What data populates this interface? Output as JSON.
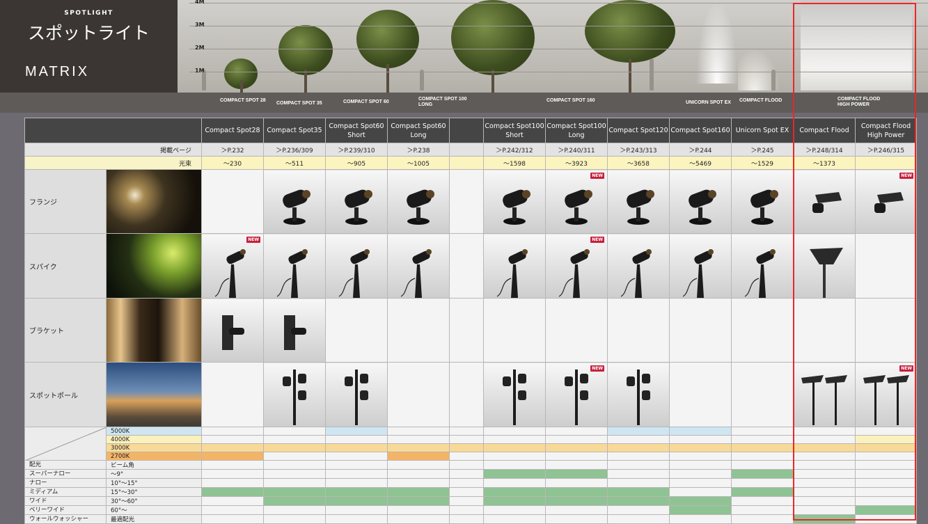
{
  "header": {
    "subtitle": "SPOTLIGHT",
    "title": "スポットライト",
    "matrix": "MATRIX"
  },
  "scale": [
    "4M",
    "3M",
    "2M",
    "1M"
  ],
  "captions": [
    "COMPACT SPOT 28",
    "COMPACT SPOT 35",
    "COMPACT SPOT 60",
    "COMPACT SPOT 100\nLONG",
    "COMPACT SPOT 160",
    "UNICORN SPOT EX",
    "COMPACT FLOOD",
    "COMPACT FLOOD\nHIGH POWER"
  ],
  "columns": [
    "Compact Spot28",
    "Compact Spot35",
    "Compact Spot60\nShort",
    "Compact Spot60\nLong",
    "",
    "Compact Spot100\nShort",
    "Compact Spot100\nLong",
    "Compact Spot120",
    "Compact Spot160",
    "Unicorn Spot EX",
    "Compact Flood",
    "Compact Flood\nHigh Power"
  ],
  "page_label": "掲載ページ",
  "pages": [
    "＞P.232",
    "＞P.236/309",
    "＞P.239/310",
    "＞P.238",
    "",
    "＞P.242/312",
    "＞P.240/311",
    "＞P.243/313",
    "＞P.244",
    "＞P.245",
    "＞P.248/314",
    "＞P.246/315"
  ],
  "lumen_label": "光束",
  "lumens": [
    "〜230",
    "〜511",
    "〜905",
    "〜1005",
    "",
    "〜1598",
    "〜3923",
    "〜3658",
    "〜5469",
    "〜1529",
    "〜1373",
    ""
  ],
  "new_badge": "NEW",
  "mounts": [
    "フランジ",
    "スパイク",
    "ブラケット",
    "スポットポール"
  ],
  "color_temps": [
    "5000K",
    "4000K",
    "3000K",
    "2700K"
  ],
  "beam_header": "配光",
  "beam_col": "ビーム角",
  "beams": [
    {
      "name": "スーパーナロー",
      "angle": "〜9°"
    },
    {
      "name": "ナロー",
      "angle": "10°〜15°"
    },
    {
      "name": "ミディアム",
      "angle": "15°〜30°"
    },
    {
      "name": "ワイド",
      "angle": "30°〜60°"
    },
    {
      "name": "ベリーワイド",
      "angle": "60°〜"
    },
    {
      "name": "ウォールウォッシャー",
      "angle": "最適配光"
    }
  ],
  "colors": {
    "highlight": "#e8262a",
    "new": "#c8203c",
    "green": "#8fc394",
    "k5000": "#cfe6f2",
    "k4000": "#fbf1bc",
    "k3000": "#f8d997",
    "k2700": "#f4b466"
  }
}
